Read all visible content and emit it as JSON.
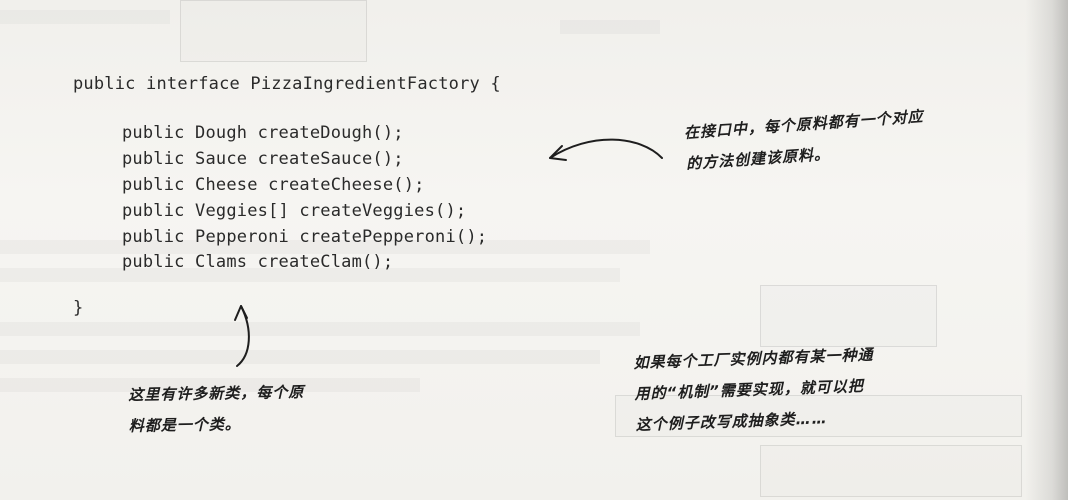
{
  "code": {
    "interface_line": "public interface PizzaIngredientFactory {",
    "methods": [
      "public Dough createDough();",
      "public Sauce createSauce();",
      "public Cheese createCheese();",
      "public Veggies[] createVeggies();",
      "public Pepperoni createPepperoni();",
      "public Clams createClam();"
    ],
    "closing_brace": "}"
  },
  "annotations": {
    "right_top": [
      "在接口中，每个原料都有一个对应",
      "的方法创建该原料。"
    ],
    "bottom_left": [
      "这里有许多新类，每个原",
      "料都是一个类。"
    ],
    "bottom_right": [
      "如果每个工厂实例内都有某一种通",
      "用的“机制”需要实现，就可以把",
      "这个例子改写成抽象类……"
    ]
  },
  "icons": {
    "arrow_right": "curved-arrow-left-icon",
    "arrow_bottom": "curved-arrow-up-icon"
  },
  "colors": {
    "paper": "#f3f2ef",
    "ink": "#2a2a2a"
  }
}
